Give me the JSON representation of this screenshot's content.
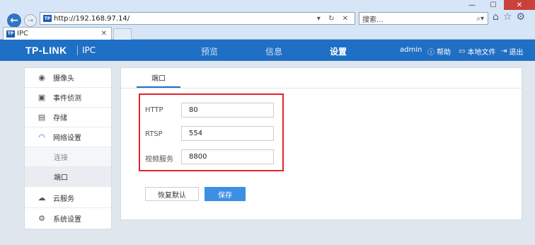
{
  "browser": {
    "address_url": "http://192.168.97.14/",
    "address_icons": "▾ ↻ ✕",
    "search_placeholder": "搜索...",
    "search_icon_glyph": "⌕▾",
    "tab_title": "IPC",
    "favicon_text": "TP"
  },
  "header": {
    "brand": "TP-LINK",
    "product": "IPC",
    "nav": [
      "预览",
      "信息",
      "设置"
    ],
    "active_nav": "设置",
    "user": "admin",
    "help": "帮助",
    "local_file": "本地文件",
    "logout": "退出"
  },
  "sidebar": {
    "items": [
      {
        "label": "摄像头",
        "icon": "camera-icon"
      },
      {
        "label": "事件侦测",
        "icon": "event-detect-icon"
      },
      {
        "label": "存储",
        "icon": "storage-icon"
      },
      {
        "label": "网络设置",
        "icon": "wifi-icon"
      },
      {
        "label": "云服务",
        "icon": "cloud-icon"
      },
      {
        "label": "系统设置",
        "icon": "gear-icon"
      }
    ],
    "sub_items": [
      "连接",
      "端口"
    ],
    "active_sub": "端口"
  },
  "main": {
    "tab": "端口",
    "fields": [
      {
        "label": "HTTP",
        "value": "80"
      },
      {
        "label": "RTSP",
        "value": "554"
      },
      {
        "label": "视频服务",
        "value": "8800"
      }
    ],
    "restore_button": "恢复默认",
    "save_button": "保存"
  },
  "colors": {
    "header_blue": "#1f6fc5",
    "highlight_red": "#e0252a",
    "save_blue": "#3d8fe3"
  }
}
